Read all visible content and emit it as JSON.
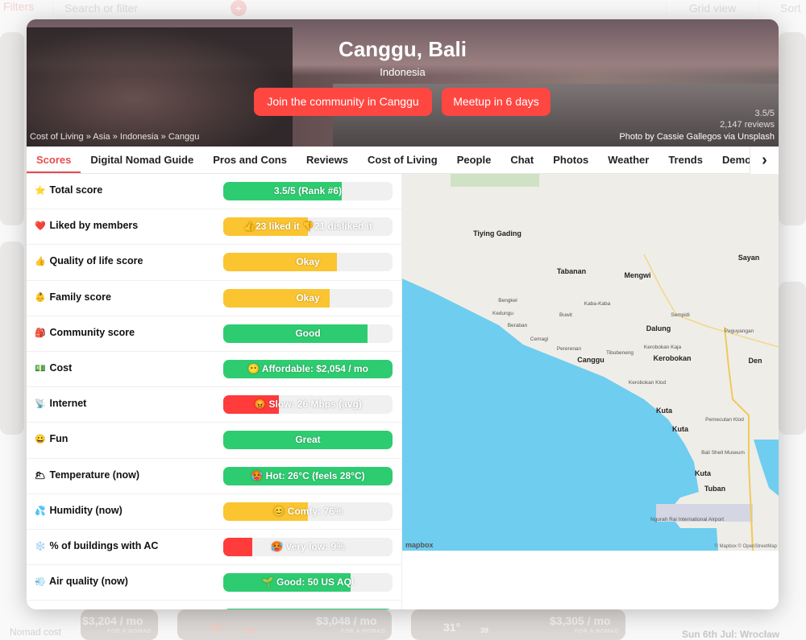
{
  "background": {
    "filters": "Filters",
    "search_placeholder": "Search or filter",
    "grid_view": "Grid view",
    "sort": "Sort",
    "nomad_cost": "Nomad cost",
    "cards": [
      {
        "price": "$3,204 / mo",
        "sub": "FOR A NOMAD"
      },
      {
        "temp": "32°",
        "aqi": "109",
        "price": "$3,048 / mo",
        "sub": "FOR A NOMAD"
      },
      {
        "temp": "31°",
        "aqi": "39",
        "price": "$3,305 / mo",
        "sub": "FOR A NOMAD"
      }
    ],
    "meetup": "Sun 6th Jul: Wrocław"
  },
  "hero": {
    "title": "Canggu, Bali",
    "country": "Indonesia",
    "join_button": "Join the community in Canggu",
    "meetup_button": "Meetup in 6 days",
    "breadcrumb": "Cost of Living » Asia » Indonesia » Canggu",
    "rating": "3.5/5",
    "reviews": "2,147 reviews",
    "credit": "Photo by Cassie Gallegos via Unsplash"
  },
  "tabs": [
    "Scores",
    "Digital Nomad Guide",
    "Pros and Cons",
    "Reviews",
    "Cost of Living",
    "People",
    "Chat",
    "Photos",
    "Weather",
    "Trends",
    "Demographics"
  ],
  "active_tab": "Scores",
  "colors": {
    "green": "#2ecc71",
    "yellow": "#fbc531",
    "red": "#ff3b3b",
    "accent": "#ff4742",
    "sea": "#6fcdef"
  },
  "scores": [
    {
      "icon": "⭐",
      "label": "Total score",
      "value": "3.5/5 (Rank #6)",
      "level": 0.7,
      "color": "#2ecc71"
    },
    {
      "icon": "❤️",
      "label": "Liked by members",
      "value": "👍23 liked it 👎21 disliked it",
      "level": 0.5,
      "color": "#fbc531"
    },
    {
      "icon": "👍",
      "label": "Quality of life score",
      "value": "Okay",
      "level": 0.67,
      "color": "#fbc531"
    },
    {
      "icon": "👶",
      "label": "Family score",
      "value": "Okay",
      "level": 0.63,
      "color": "#fbc531"
    },
    {
      "icon": "🎒",
      "label": "Community score",
      "value": "Good",
      "level": 0.85,
      "color": "#2ecc71"
    },
    {
      "icon": "💵",
      "label": "Cost",
      "value": "😶 Affordable: $2,054 / mo",
      "level": 1.0,
      "color": "#2ecc71"
    },
    {
      "icon": "📡",
      "label": "Internet",
      "value": "😡 Slow: 26 Mbps (avg)",
      "level": 0.33,
      "color": "#ff3b3b"
    },
    {
      "icon": "😀",
      "label": "Fun",
      "value": "Great",
      "level": 1.0,
      "color": "#2ecc71"
    },
    {
      "icon": "🌥",
      "label": "Temperature (now)",
      "value": "🥵 Hot: 26°C (feels 28°C)",
      "level": 1.0,
      "color": "#2ecc71"
    },
    {
      "icon": "💦",
      "label": "Humidity (now)",
      "value": "😊 Comfy: 76%",
      "level": 0.5,
      "color": "#fbc531"
    },
    {
      "icon": "❄️",
      "label": "% of buildings with AC",
      "value": "🥵 Very low: 9%",
      "level": 0.17,
      "color": "#ff3b3b"
    },
    {
      "icon": "💨",
      "label": "Air quality (now)",
      "value": "🌱 Good: 50 US AQI",
      "level": 0.75,
      "color": "#2ecc71"
    }
  ],
  "map": {
    "labels": [
      "Tiying Gading",
      "Tabanan",
      "Mengwi",
      "Sayan",
      "Dalung",
      "Canggu",
      "Kerobokan",
      "Kerobokan Kaja",
      "Kerobokan Klod",
      "Kuta",
      "Kuta",
      "Kuta",
      "Tuban",
      "Pemecutan Klod",
      "Bali Shell Museum",
      "Ngurah Rai International Airport",
      "Kaba-Kaba",
      "Buwit",
      "Cemagi",
      "Pererenan",
      "Tibubeneng",
      "Beraban",
      "Kedungu",
      "Bengkel",
      "Sempidi",
      "Peguyangan",
      "Den"
    ],
    "logo": "mapbox",
    "attribution": "© Mapbox © OpenStreetMap"
  }
}
